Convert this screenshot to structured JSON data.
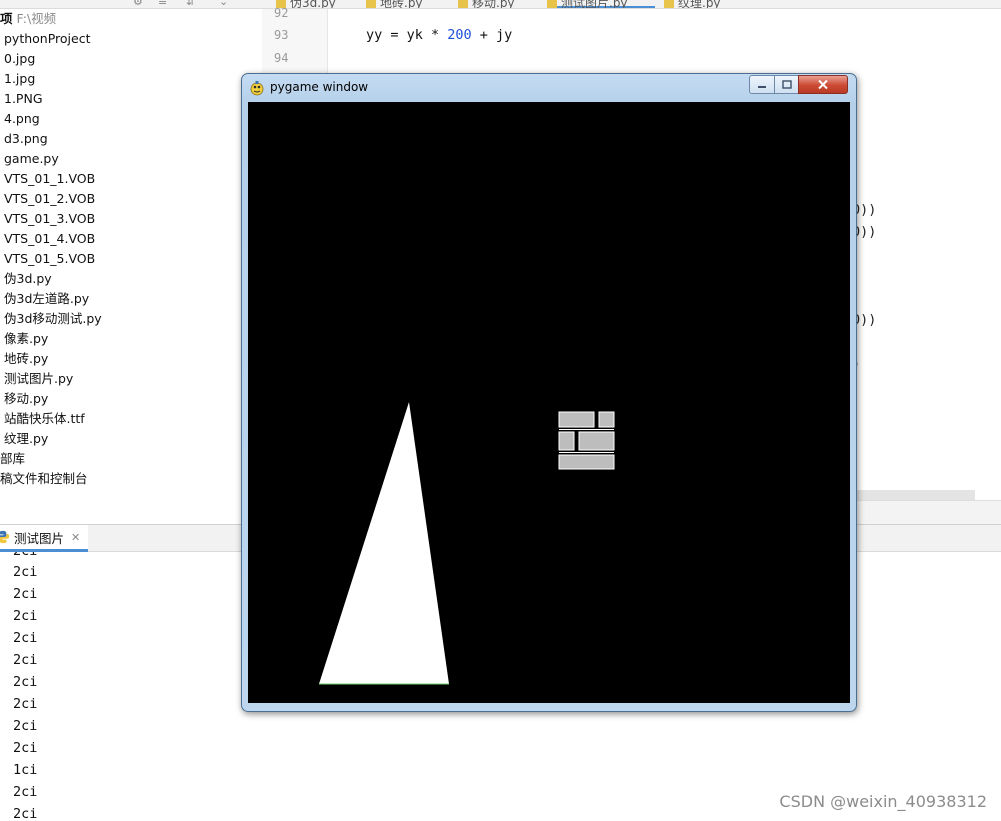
{
  "ide": {
    "editor_tabs": [
      {
        "label": "伪3d.py",
        "active": false
      },
      {
        "label": "地砖.py",
        "active": false
      },
      {
        "label": "移动.py",
        "active": false
      },
      {
        "label": "测试图片.py",
        "active": true
      },
      {
        "label": "纹理.py",
        "active": false
      }
    ],
    "project_root": {
      "label": "项",
      "path": "F:\\视频"
    },
    "project_files": [
      "pythonProject",
      "0.jpg",
      "1.jpg",
      "1.PNG",
      "4.png",
      "d3.png",
      "game.py",
      "VTS_01_1.VOB",
      "VTS_01_2.VOB",
      "VTS_01_3.VOB",
      "VTS_01_4.VOB",
      "VTS_01_5.VOB",
      "伪3d.py",
      "伪3d左道路.py",
      "伪3d移动测试.py",
      "像素.py",
      "地砖.py",
      "测试图片.py",
      "移动.py",
      "站酷快乐体.ttf",
      "纹理.py"
    ],
    "external_libraries": "部库",
    "scratches": "稿文件和控制台",
    "line_numbers": [
      "92",
      "93",
      "94"
    ],
    "code": {
      "line_93_prefix": "yy = yk * ",
      "line_93_number": "200",
      "line_93_suffix": " + jy",
      "right_fragments": [
        "0))",
        "0))",
        "0))",
        ")"
      ]
    },
    "run_tab_label": "测试图片",
    "console_lines": [
      "2ci",
      "2ci",
      "2ci",
      "2ci",
      "2ci",
      "2ci",
      "2ci",
      "2ci",
      "2ci",
      "2ci",
      "1ci",
      "2ci",
      "2ci"
    ]
  },
  "pygame": {
    "title": "pygame window",
    "icon": "pygame-snake-icon",
    "canvas_background": "#000000",
    "triangle_color": "#ffffff",
    "brick_color": "#bdbdbd"
  },
  "watermark": "CSDN @weixin_40938312"
}
